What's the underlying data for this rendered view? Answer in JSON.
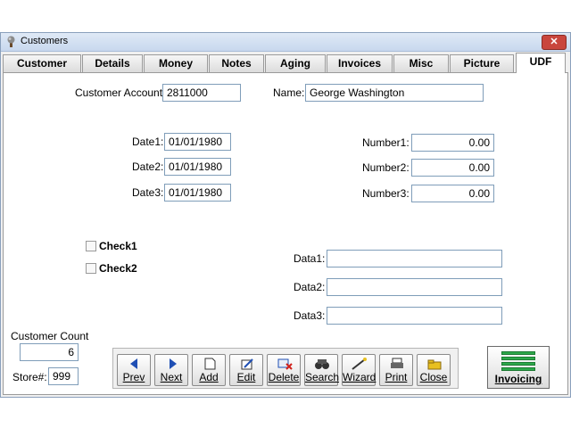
{
  "window": {
    "title": "Customers",
    "close_glyph": "✕"
  },
  "tabs": [
    {
      "label": "Customer"
    },
    {
      "label": "Details"
    },
    {
      "label": "Money"
    },
    {
      "label": "Notes"
    },
    {
      "label": "Aging"
    },
    {
      "label": "Invoices"
    },
    {
      "label": "Misc"
    },
    {
      "label": "Picture"
    },
    {
      "label": "UDF"
    }
  ],
  "form": {
    "customer_account_label": "Customer Account:",
    "customer_account_value": "2811000",
    "name_label": "Name:",
    "name_value": "George Washington",
    "date1_label": "Date1:",
    "date1_value": "01/01/1980",
    "date2_label": "Date2:",
    "date2_value": "01/01/1980",
    "date3_label": "Date3:",
    "date3_value": "01/01/1980",
    "number1_label": "Number1:",
    "number1_value": "0.00",
    "number2_label": "Number2:",
    "number2_value": "0.00",
    "number3_label": "Number3:",
    "number3_value": "0.00",
    "check1_label": "Check1",
    "check2_label": "Check2",
    "data1_label": "Data1:",
    "data1_value": "",
    "data2_label": "Data2:",
    "data2_value": "",
    "data3_label": "Data3:",
    "data3_value": ""
  },
  "footer": {
    "customer_count_label": "Customer Count",
    "customer_count_value": "6",
    "store_label": "Store#:",
    "store_value": "999"
  },
  "nav": {
    "prev": "Prev",
    "next": "Next",
    "add": "Add",
    "edit": "Edit",
    "delete": "Delete",
    "search": "Search",
    "wizard": "Wizard",
    "print": "Print",
    "close": "Close"
  },
  "invoicing_label": "Invoicing",
  "colors": {
    "accent_blue": "#1f4fb4",
    "invoicing_green": "#2da84a",
    "delete_red": "#d0201a"
  }
}
